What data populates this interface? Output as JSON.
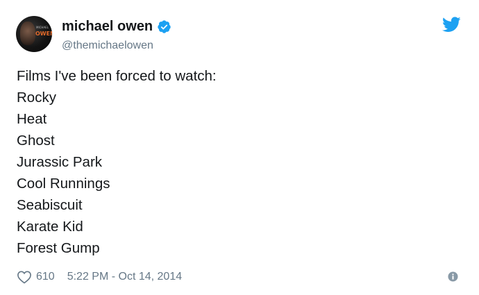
{
  "author": {
    "display_name": "michael owen",
    "handle": "@themichaelowen",
    "verified": true,
    "avatar_text": "OWEN",
    "avatar_small_text": "MICHAEL"
  },
  "tweet": {
    "lines": [
      "Films I've been forced to watch:",
      "Rocky",
      "Heat",
      "Ghost",
      "Jurassic Park",
      "Cool Runnings",
      "Seabiscuit",
      "Karate Kid",
      "Forest Gump"
    ],
    "likes": "610",
    "timestamp": "5:22 PM - Oct 14, 2014"
  },
  "icons": {
    "verified": "verified-badge-icon",
    "brand": "twitter-bird-icon",
    "like": "heart-icon",
    "info": "info-icon"
  },
  "colors": {
    "twitter_blue": "#1da1f2",
    "text_primary": "#14171a",
    "text_secondary": "#657786"
  }
}
